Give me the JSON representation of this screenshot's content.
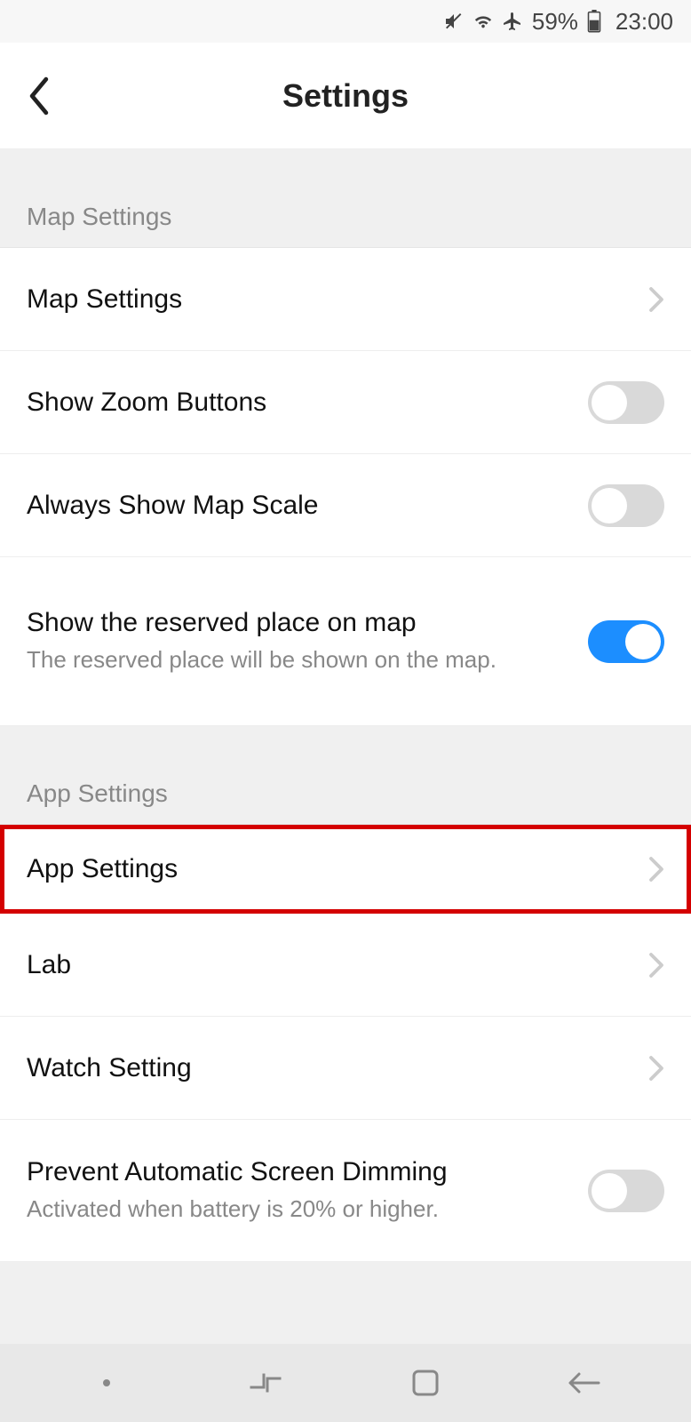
{
  "status": {
    "battery": "59%",
    "time": "23:00"
  },
  "header": {
    "title": "Settings"
  },
  "sections": {
    "map": {
      "header": "Map Settings",
      "items": {
        "mapSettings": "Map Settings",
        "zoom": "Show Zoom Buttons",
        "scale": "Always Show Map Scale",
        "reserved_title": "Show the reserved place on map",
        "reserved_sub": "The reserved place will be shown on the map."
      }
    },
    "app": {
      "header": "App Settings",
      "items": {
        "appSettings": "App Settings",
        "lab": "Lab",
        "watch": "Watch Setting",
        "dim_title": "Prevent Automatic Screen Dimming",
        "dim_sub": "Activated when battery is 20% or higher."
      }
    }
  }
}
